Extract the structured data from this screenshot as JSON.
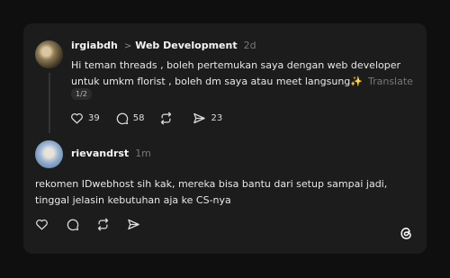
{
  "post": {
    "username": "irgiabdh",
    "separator": ">",
    "topic": "Web Development",
    "time": "2d",
    "text": "Hi teman threads , boleh pertemukan saya dengan web developer untuk umkm florist , boleh dm saya atau meet langsung✨",
    "translate_label": "Translate",
    "pager": "1/2",
    "likes": "39",
    "replies": "58",
    "shares": "23"
  },
  "reply": {
    "username": "rievandrst",
    "time": "1m",
    "text": "rekomen IDwebhost sih kak, mereka bisa bantu dari setup sampai jadi, tinggal jelasin kebutuhan aja ke CS-nya"
  },
  "icons": {
    "like": "heart-icon",
    "reply": "comment-icon",
    "repost": "repost-icon",
    "share": "send-icon",
    "brand": "threads-logo-icon"
  },
  "colors": {
    "background": "#0f0f0f",
    "card": "#1c1c1c",
    "text": "#f3f5f7",
    "muted": "#777777"
  }
}
